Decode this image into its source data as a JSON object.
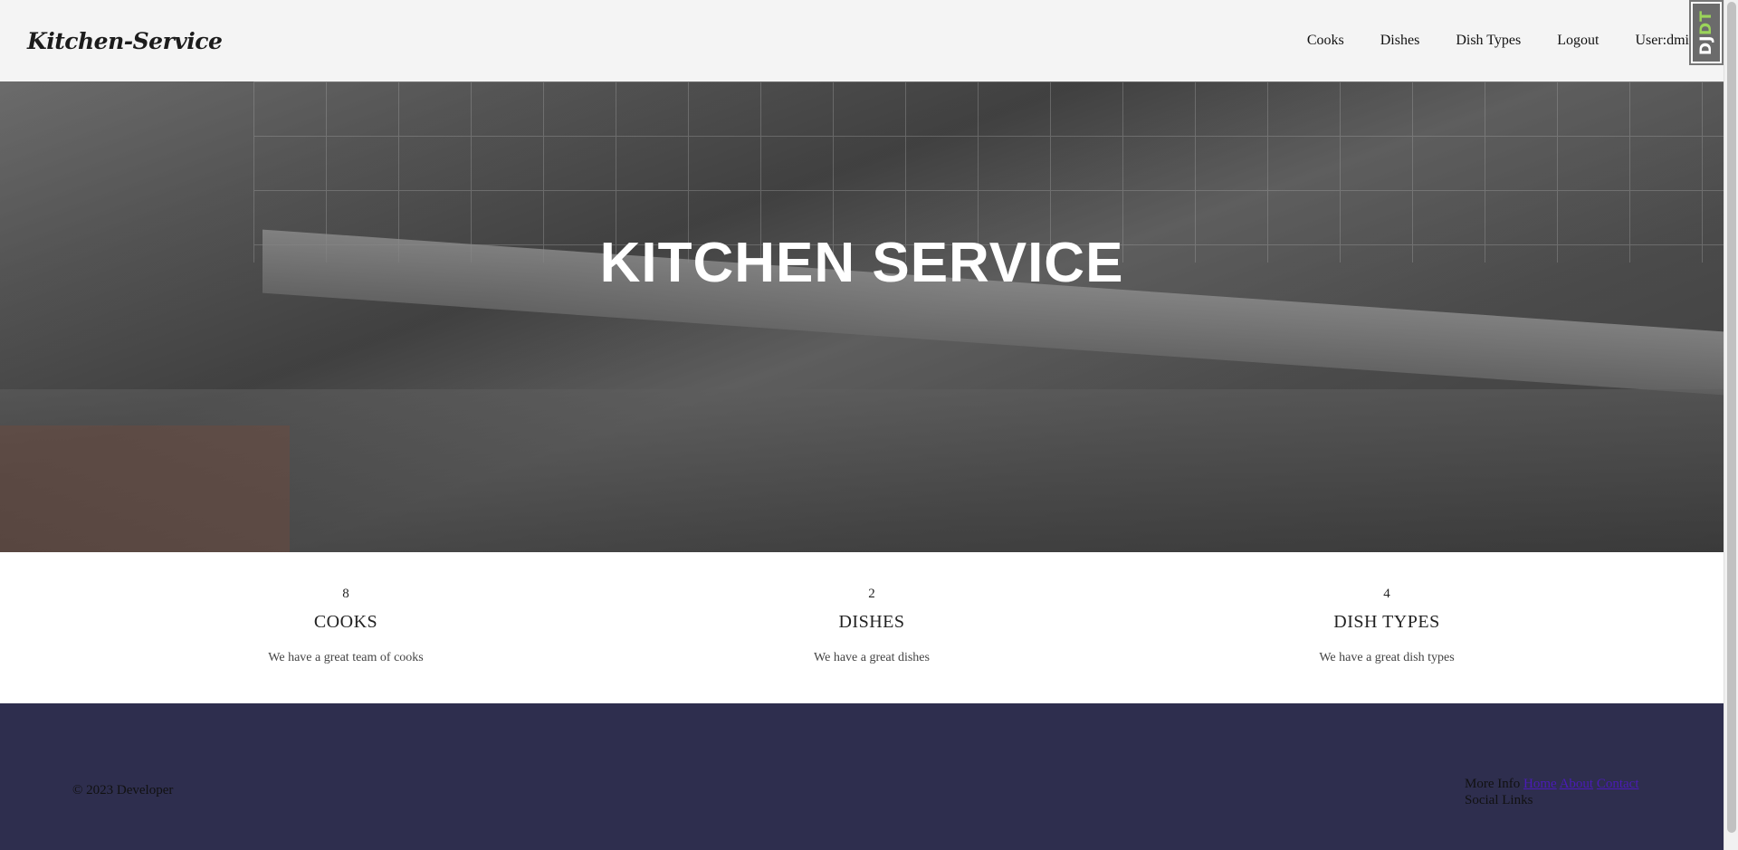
{
  "header": {
    "brand": "Kitchen-Service",
    "nav": [
      "Cooks",
      "Dishes",
      "Dish Types",
      "Logout"
    ],
    "user": "User:dmin"
  },
  "djdt": {
    "label_dj": "DJ",
    "label_dt": "DT"
  },
  "hero": {
    "title": "KITCHEN SERVICE"
  },
  "stats": [
    {
      "number": "8",
      "label": "COOKS",
      "description": "We have a great team of cooks"
    },
    {
      "number": "2",
      "label": "DISHES",
      "description": "We have a great dishes"
    },
    {
      "number": "4",
      "label": "DISH TYPES",
      "description": "We have a great dish types"
    }
  ],
  "footer": {
    "copyright": "© 2023 Developer",
    "more_info_label": "More Info",
    "links": [
      "Home",
      "About",
      "Contact"
    ],
    "social_label": "Social Links"
  }
}
